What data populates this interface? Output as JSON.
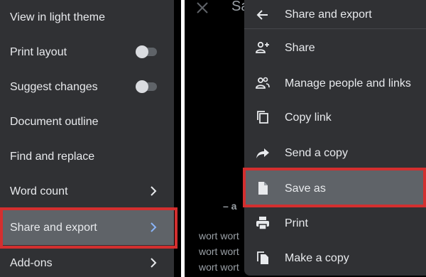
{
  "left_menu": {
    "items": [
      {
        "label": "View in light theme",
        "control": "none"
      },
      {
        "label": "Print layout",
        "control": "toggle",
        "on": false
      },
      {
        "label": "Suggest changes",
        "control": "toggle",
        "on": false
      },
      {
        "label": "Document outline",
        "control": "none"
      },
      {
        "label": "Find and replace",
        "control": "none"
      },
      {
        "label": "Word count",
        "control": "chevron"
      },
      {
        "label": "Share and export",
        "control": "chevron",
        "active": true
      },
      {
        "label": "Add-ons",
        "control": "chevron"
      }
    ]
  },
  "document": {
    "title_fragment": "Sa",
    "dash_fragment": "– a",
    "body_lines": [
      "wort wort",
      "wort wort",
      "wort wort"
    ]
  },
  "share_menu": {
    "header": "Share and export",
    "items": [
      {
        "label": "Share",
        "icon": "person-add-icon"
      },
      {
        "label": "Manage people and links",
        "icon": "people-icon"
      },
      {
        "label": "Copy link",
        "icon": "copy-icon"
      },
      {
        "label": "Send a copy",
        "icon": "forward-arrow-icon"
      },
      {
        "label": "Save as",
        "icon": "file-icon",
        "active": true
      },
      {
        "label": "Print",
        "icon": "printer-icon"
      },
      {
        "label": "Make a copy",
        "icon": "make-copy-icon"
      }
    ]
  },
  "colors": {
    "menu_bg": "#303134",
    "active_bg": "#5f6368",
    "highlight": "#d32f2f",
    "text": "#e8eaed"
  }
}
